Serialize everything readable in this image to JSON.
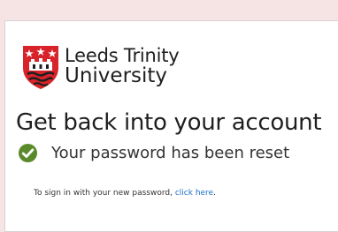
{
  "colors": {
    "background": "#f6e4e4",
    "card": "#ffffff",
    "crest_red": "#d8232a",
    "check_green": "#5b8a2d",
    "link": "#1e6fc8"
  },
  "logo": {
    "line1": "Leeds Trinity",
    "line2": "University",
    "icon": "university-crest"
  },
  "heading": "Get back into your account",
  "status": {
    "icon": "check-circle-icon",
    "text": "Your password has been reset"
  },
  "signin": {
    "prefix": "To sign in with your new password, ",
    "link_text": "click here",
    "suffix": "."
  }
}
